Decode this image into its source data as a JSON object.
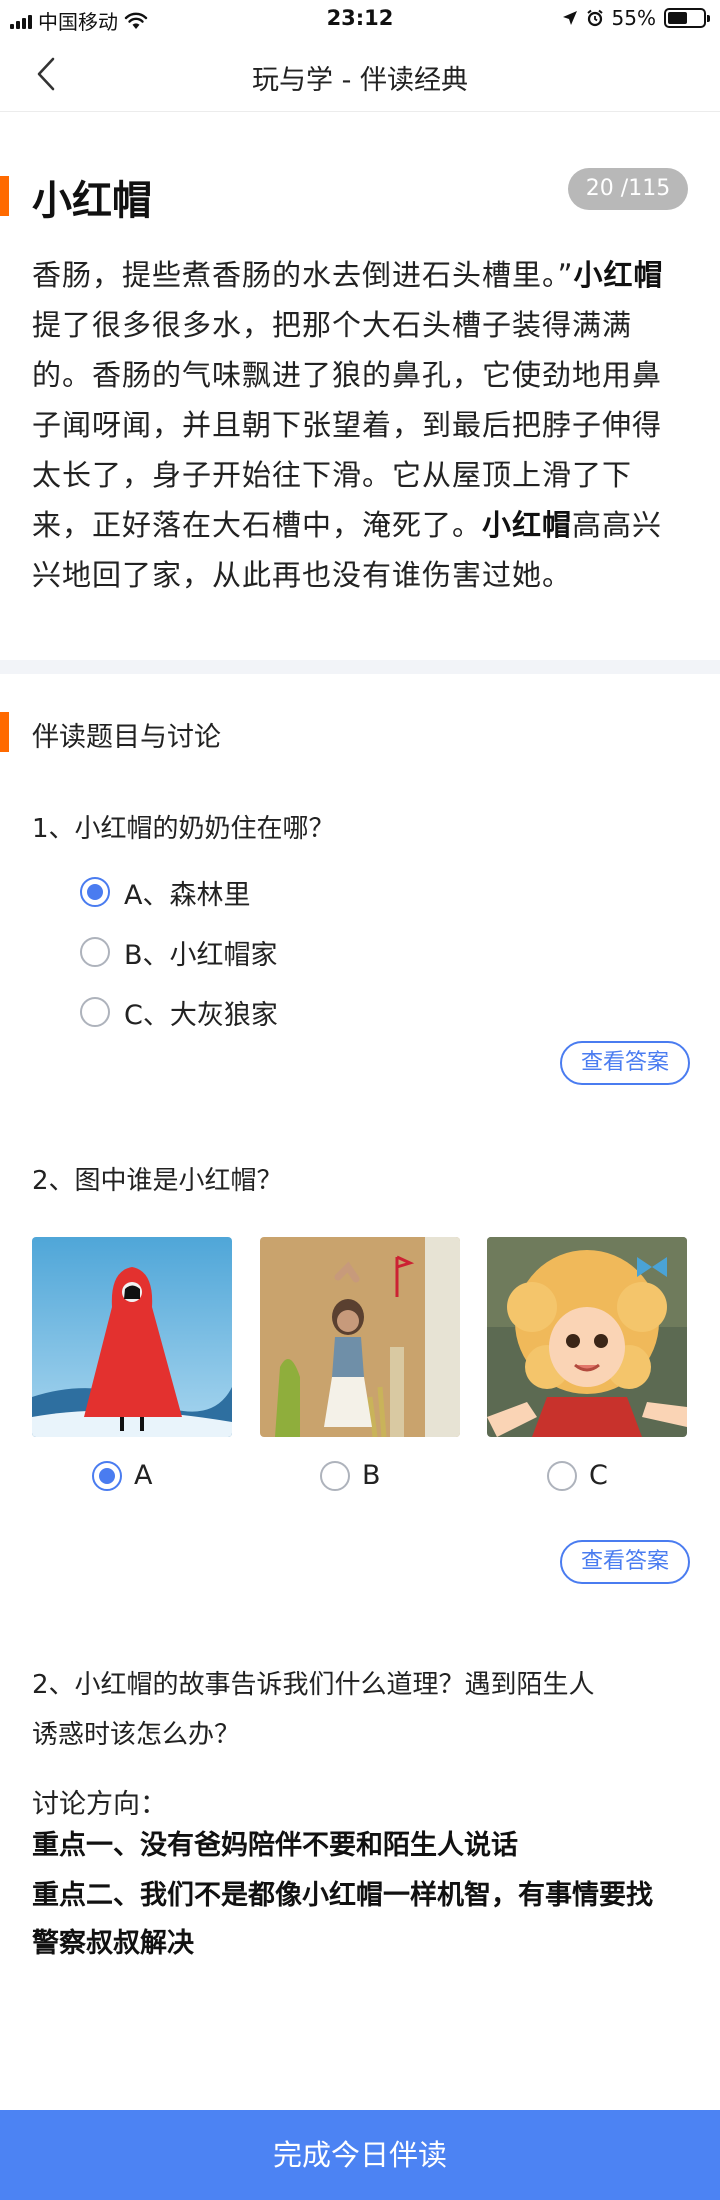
{
  "status_bar": {
    "carrier": "中国移动",
    "time": "23:12",
    "battery": "55%",
    "battery_level": 0.55
  },
  "nav": {
    "title": "玩与学 - 伴读经典"
  },
  "story": {
    "title": "小红帽",
    "page_current": "20",
    "page_total": "/115",
    "text_parts": [
      "香肠，提些煮香肠的水去倒进石头槽里。”",
      "小红帽",
      "提了很多很多水，把那个大石头槽子装得满满的。香肠的气味飘进了狼的鼻孔，它使劲地用鼻子闻呀闻，并且朝下张望着，到最后把脖子伸得太长了，身子开始往下滑。它从屋顶上滑了下来，正好落在大石槽中，淹死了。",
      "小红帽",
      "高高兴兴地回了家，从此再也没有谁伤害过她。"
    ]
  },
  "discussion": {
    "heading": "伴读题目与讨论",
    "q1": {
      "text": "1、小红帽的奶奶住在哪？",
      "options": [
        {
          "label": "A、森林里",
          "checked": true
        },
        {
          "label": "B、小红帽家",
          "checked": false
        },
        {
          "label": "C、大灰狼家",
          "checked": false
        }
      ]
    },
    "q2": {
      "text": "2、图中谁是小红帽？",
      "options": [
        {
          "label": "A",
          "checked": true
        },
        {
          "label": "B",
          "checked": false
        },
        {
          "label": "C",
          "checked": false
        }
      ]
    },
    "answer_button": "查看答案",
    "q3": {
      "text_line1": "2、小红帽的故事告诉我们什么道理？遇到陌生人",
      "text_line2": "诱惑时该怎么办？"
    },
    "direction_label": "讨论方向：",
    "point1": "重点一、没有爸妈陪伴不要和陌生人说话",
    "point2": "重点二、我们不是都像小红帽一样机智，有事情要找警察叔叔解决"
  },
  "footer": {
    "button": "完成今日伴读"
  },
  "colors": {
    "accent": "#ff6a00",
    "primary": "#4c83f3",
    "radio_checked": "#4a7cf0"
  }
}
